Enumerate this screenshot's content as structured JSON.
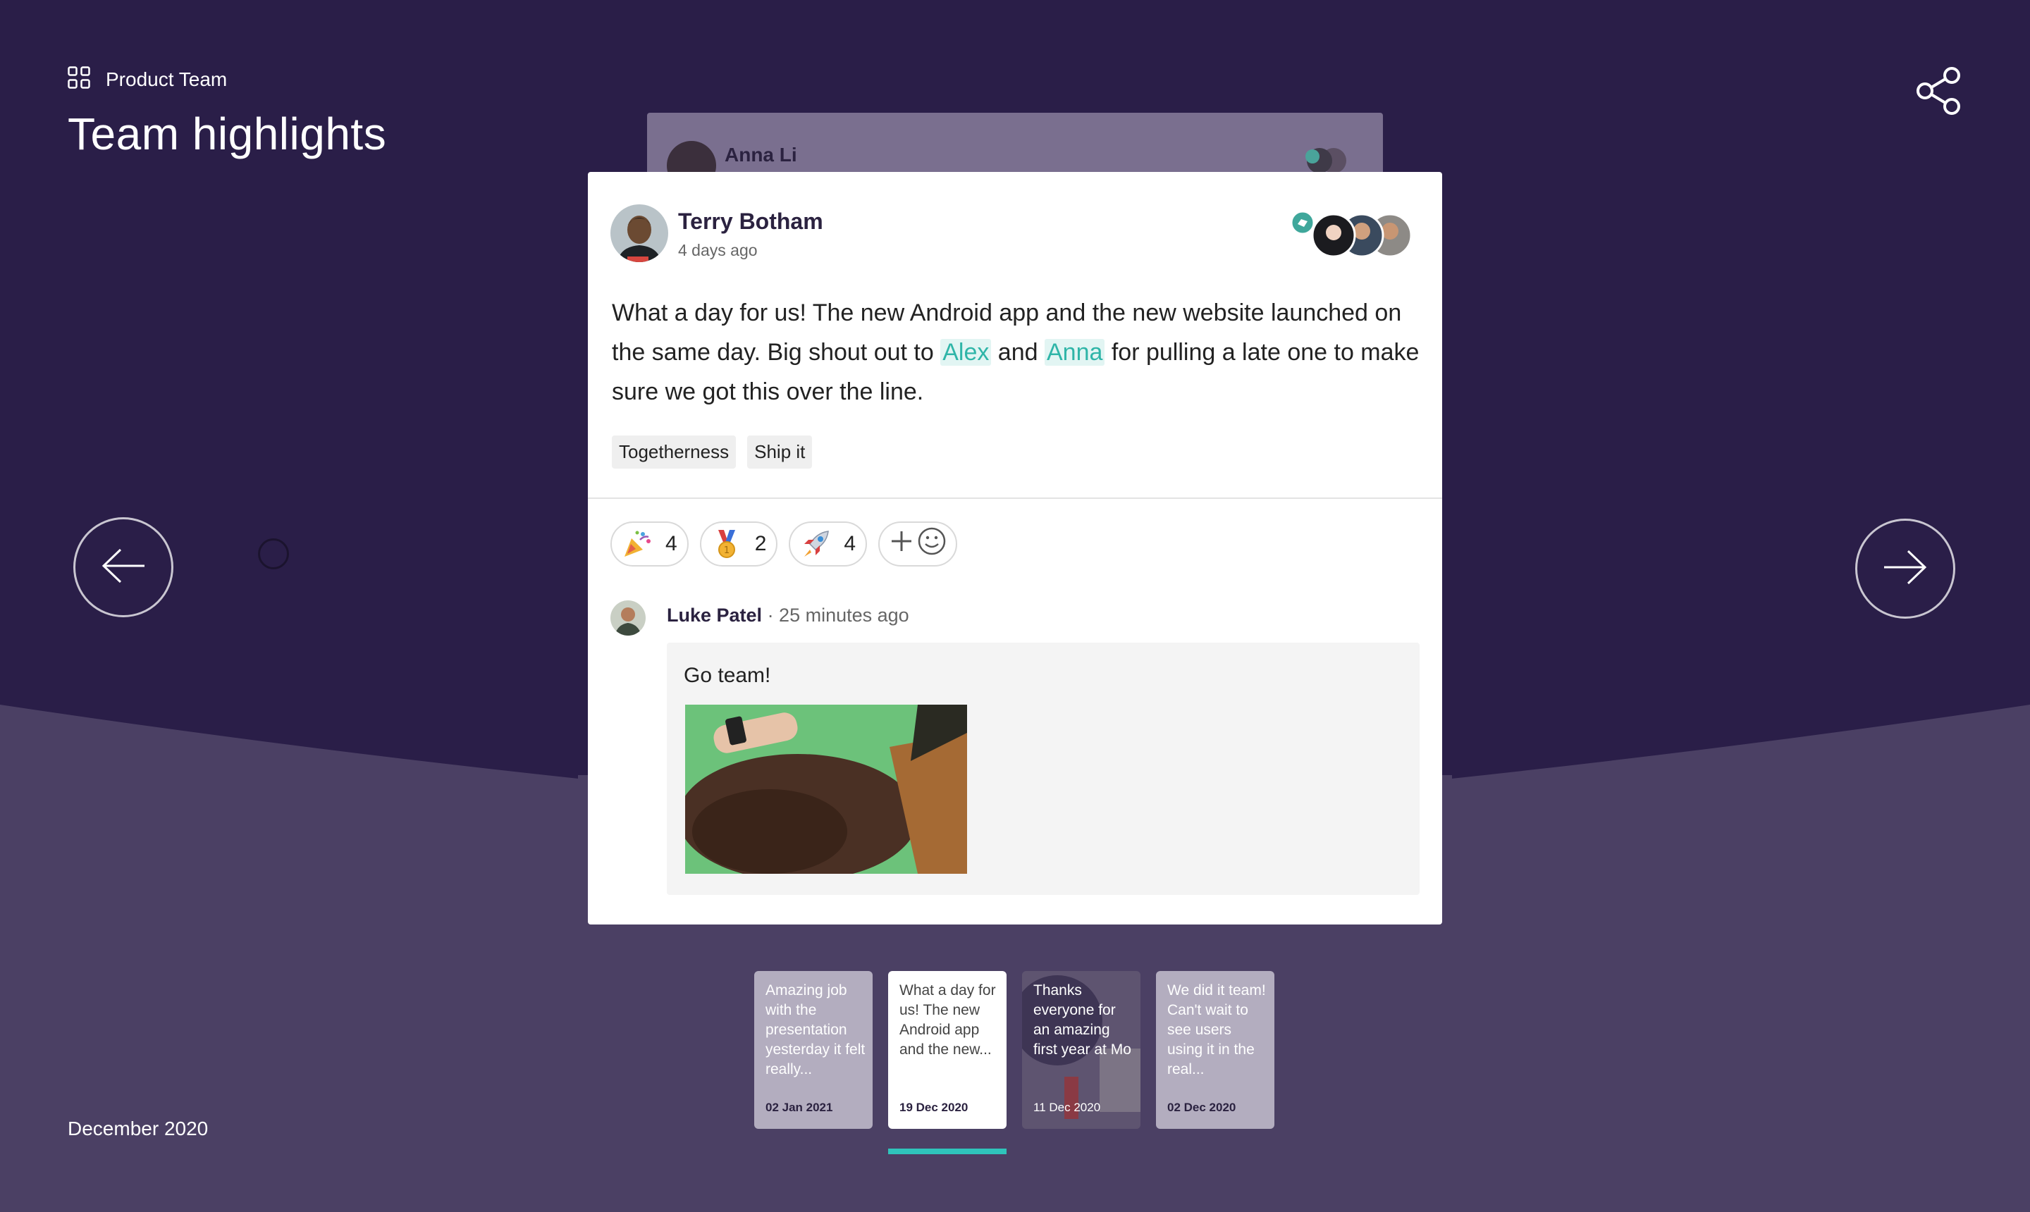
{
  "header": {
    "team_name": "Product Team",
    "title": "Team highlights"
  },
  "back_card": {
    "author": "Anna Li"
  },
  "post": {
    "author": "Terry Botham",
    "time": "4 days ago",
    "text_part1": "What a day for us! The new Android app and the new website launched on the same day. Big shout out to ",
    "mention1": "Alex",
    "text_part2": " and ",
    "mention2": "Anna",
    "text_part3": " for pulling a late one to make sure we got this over the line.",
    "tags": [
      "Togetherness",
      "Ship it"
    ],
    "reactions": [
      {
        "emoji": "party-popper-icon",
        "count": "4"
      },
      {
        "emoji": "medal-icon",
        "count": "2"
      },
      {
        "emoji": "rocket-icon",
        "count": "4"
      }
    ],
    "comment": {
      "author": "Luke Patel",
      "time": " · 25 minutes ago",
      "text": "Go team!"
    }
  },
  "footer": {
    "month": "December 2020"
  },
  "thumbnails": [
    {
      "text": "Amazing job with the presentation yesterday it felt really...",
      "date": "02 Jan 2021"
    },
    {
      "text": "What a day for us! The new Android app and the new...",
      "date": "19 Dec 2020"
    },
    {
      "text": "Thanks everyone for an amazing first year at Mo",
      "date": "11 Dec 2020"
    },
    {
      "text": "We did it team! Can't wait to see users using it in the real...",
      "date": "02 Dec 2020"
    }
  ],
  "colors": {
    "background_dark": "#2a1e48",
    "background_lower": "#4b4064",
    "accent": "#2fc4bb",
    "mention": "#2fb5a8"
  }
}
